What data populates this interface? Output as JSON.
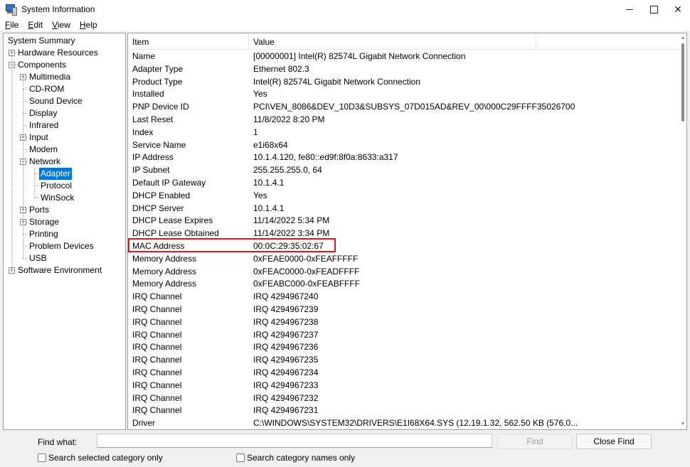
{
  "window": {
    "title": "System Information",
    "icon": "system-information-icon"
  },
  "window_controls": {
    "minimize_icon": "minimize-icon",
    "maximize_icon": "maximize-icon",
    "close_glyph": "✕"
  },
  "menu": [
    {
      "label": "File",
      "accel": "F",
      "rest": "ile"
    },
    {
      "label": "Edit",
      "accel": "E",
      "rest": "dit"
    },
    {
      "label": "View",
      "accel": "V",
      "rest": "iew"
    },
    {
      "label": "Help",
      "accel": "H",
      "rest": "elp"
    }
  ],
  "tree": [
    {
      "label": "System Summary",
      "depth": 0,
      "expander": ""
    },
    {
      "label": "Hardware Resources",
      "depth": 1,
      "expander": "+"
    },
    {
      "label": "Components",
      "depth": 1,
      "expander": "−"
    },
    {
      "label": "Multimedia",
      "depth": 2,
      "expander": "+"
    },
    {
      "label": "CD-ROM",
      "depth": 2,
      "expander": ""
    },
    {
      "label": "Sound Device",
      "depth": 2,
      "expander": ""
    },
    {
      "label": "Display",
      "depth": 2,
      "expander": ""
    },
    {
      "label": "Infrared",
      "depth": 2,
      "expander": ""
    },
    {
      "label": "Input",
      "depth": 2,
      "expander": "+"
    },
    {
      "label": "Modem",
      "depth": 2,
      "expander": ""
    },
    {
      "label": "Network",
      "depth": 2,
      "expander": "−"
    },
    {
      "label": "Adapter",
      "depth": 3,
      "expander": "",
      "selected": true
    },
    {
      "label": "Protocol",
      "depth": 3,
      "expander": ""
    },
    {
      "label": "WinSock",
      "depth": 3,
      "expander": ""
    },
    {
      "label": "Ports",
      "depth": 2,
      "expander": "+"
    },
    {
      "label": "Storage",
      "depth": 2,
      "expander": "+"
    },
    {
      "label": "Printing",
      "depth": 2,
      "expander": ""
    },
    {
      "label": "Problem Devices",
      "depth": 2,
      "expander": ""
    },
    {
      "label": "USB",
      "depth": 2,
      "expander": ""
    },
    {
      "label": "Software Environment",
      "depth": 1,
      "expander": "+"
    }
  ],
  "table": {
    "columns": [
      "Item",
      "Value"
    ],
    "rows": [
      [
        "Name",
        "[00000001] Intel(R) 82574L Gigabit Network Connection"
      ],
      [
        "Adapter Type",
        "Ethernet 802.3"
      ],
      [
        "Product Type",
        "Intel(R) 82574L Gigabit Network Connection"
      ],
      [
        "Installed",
        "Yes"
      ],
      [
        "PNP Device ID",
        "PCI\\VEN_8086&DEV_10D3&SUBSYS_07D015AD&REV_00\\000C29FFFF35026700"
      ],
      [
        "Last Reset",
        "11/8/2022 8:20 PM"
      ],
      [
        "Index",
        "1"
      ],
      [
        "Service Name",
        "e1i68x64"
      ],
      [
        "IP Address",
        "10.1.4.120, fe80::ed9f:8f0a:8633:a317"
      ],
      [
        "IP Subnet",
        "255.255.255.0, 64"
      ],
      [
        "Default IP Gateway",
        "10.1.4.1"
      ],
      [
        "DHCP Enabled",
        "Yes"
      ],
      [
        "DHCP Server",
        "10.1.4.1"
      ],
      [
        "DHCP Lease Expires",
        "11/14/2022 5:34 PM"
      ],
      [
        "DHCP Lease Obtained",
        "11/14/2022 3:34 PM"
      ],
      [
        "MAC Address",
        "00:0C:29:35:02:67"
      ],
      [
        "Memory Address",
        "0xFEAE0000-0xFEAFFFFF"
      ],
      [
        "Memory Address",
        "0xFEAC0000-0xFEADFFFF"
      ],
      [
        "Memory Address",
        "0xFEABC000-0xFEABFFFF"
      ],
      [
        "IRQ Channel",
        "IRQ 4294967240"
      ],
      [
        "IRQ Channel",
        "IRQ 4294967239"
      ],
      [
        "IRQ Channel",
        "IRQ 4294967238"
      ],
      [
        "IRQ Channel",
        "IRQ 4294967237"
      ],
      [
        "IRQ Channel",
        "IRQ 4294967236"
      ],
      [
        "IRQ Channel",
        "IRQ 4294967235"
      ],
      [
        "IRQ Channel",
        "IRQ 4294967234"
      ],
      [
        "IRQ Channel",
        "IRQ 4294967233"
      ],
      [
        "IRQ Channel",
        "IRQ 4294967232"
      ],
      [
        "IRQ Channel",
        "IRQ 4294967231"
      ],
      [
        "Driver",
        "C:\\WINDOWS\\SYSTEM32\\DRIVERS\\E1I68X64.SYS (12.19.1.32, 562.50 KB (576,0..."
      ]
    ],
    "highlighted_row_item": "MAC Address",
    "highlight_color": "#e2141f"
  },
  "find": {
    "label": "Find what:",
    "value": "",
    "find_button": "Find",
    "close_find_button": "Close Find",
    "search_selected_category_only": "Search selected category only",
    "search_category_names_only": "Search category names only",
    "search_selected_checked": false,
    "search_names_checked": false
  },
  "colors": {
    "selection": "#0078d7",
    "highlight": "#e2141f"
  }
}
